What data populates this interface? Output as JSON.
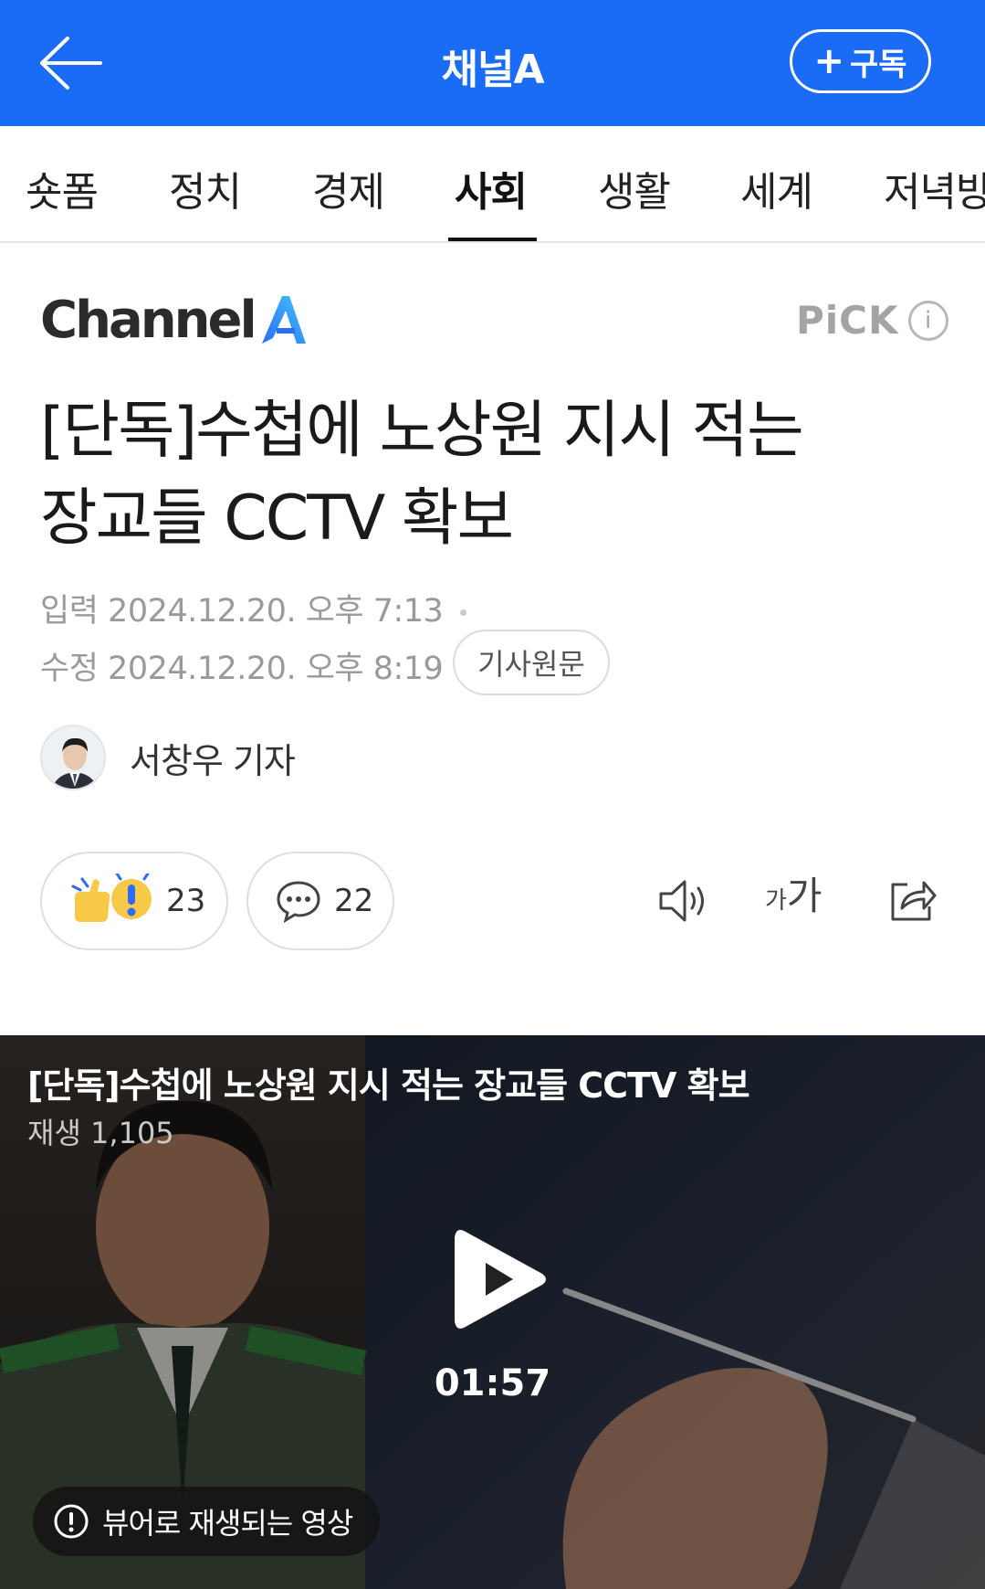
{
  "topbar": {
    "title": "채널A",
    "subscribe_label": "구독",
    "subscribe_plus": "+"
  },
  "tabs": [
    {
      "label": "숏폼",
      "active": false
    },
    {
      "label": "정치",
      "active": false
    },
    {
      "label": "경제",
      "active": false
    },
    {
      "label": "사회",
      "active": true
    },
    {
      "label": "생활",
      "active": false
    },
    {
      "label": "세계",
      "active": false
    },
    {
      "label": "저녁방",
      "active": false
    }
  ],
  "article": {
    "brand": "Channel",
    "brand_mark": "A",
    "pick_label": "PiCK",
    "pick_info": "i",
    "headline_line1": "[단독]수첩에 노상원 지시 적는",
    "headline_line2": "장교들 CCTV 확보",
    "published_label": "입력",
    "published_value": "2024.12.20. 오후 7:13",
    "modified_label": "수정",
    "modified_value": "2024.12.20. 오후 8:19",
    "original_button": "기사원문",
    "reporter": "서창우 기자",
    "reaction_count": "23",
    "comment_count": "22",
    "font_tool_label_small": "가",
    "font_tool_label_large": "가"
  },
  "video": {
    "title": "[단독]수첩에 노상원 지시 적는 장교들 CCTV 확보",
    "plays": "재생 1,105",
    "duration": "01:57",
    "viewer_notice": "뷰어로 재생되는 영상"
  },
  "colors": {
    "brand_blue": "#1a6bf5",
    "reaction_yellow": "#f7c948",
    "reaction_blue": "#2d6cf6"
  },
  "icons": [
    "back-arrow-icon",
    "speaker-icon",
    "font-size-icon",
    "share-icon",
    "comment-icon",
    "reaction-icon",
    "play-icon",
    "info-icon"
  ]
}
